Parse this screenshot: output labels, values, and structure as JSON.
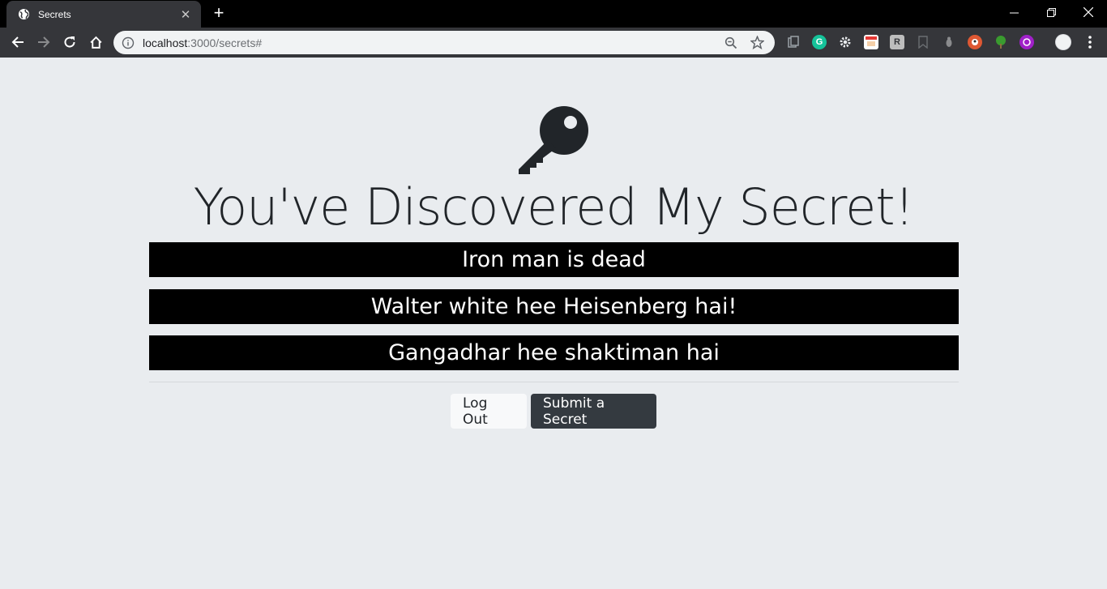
{
  "browser": {
    "tab_title": "Secrets",
    "tab_close": "✕",
    "new_tab": "+",
    "url_host": "localhost",
    "url_path": ":3000/secrets#"
  },
  "page": {
    "icon": "key-icon",
    "heading": "You've Discovered My Secret!",
    "secrets": [
      "Iron man is dead",
      "Walter white hee Heisenberg hai!",
      "Gangadhar hee shaktiman hai"
    ],
    "buttons": {
      "logout": "Log Out",
      "submit": "Submit a Secret"
    }
  },
  "colors": {
    "background": "#e9ecef",
    "secret_bg": "#000000",
    "dark_button": "#343a40"
  }
}
